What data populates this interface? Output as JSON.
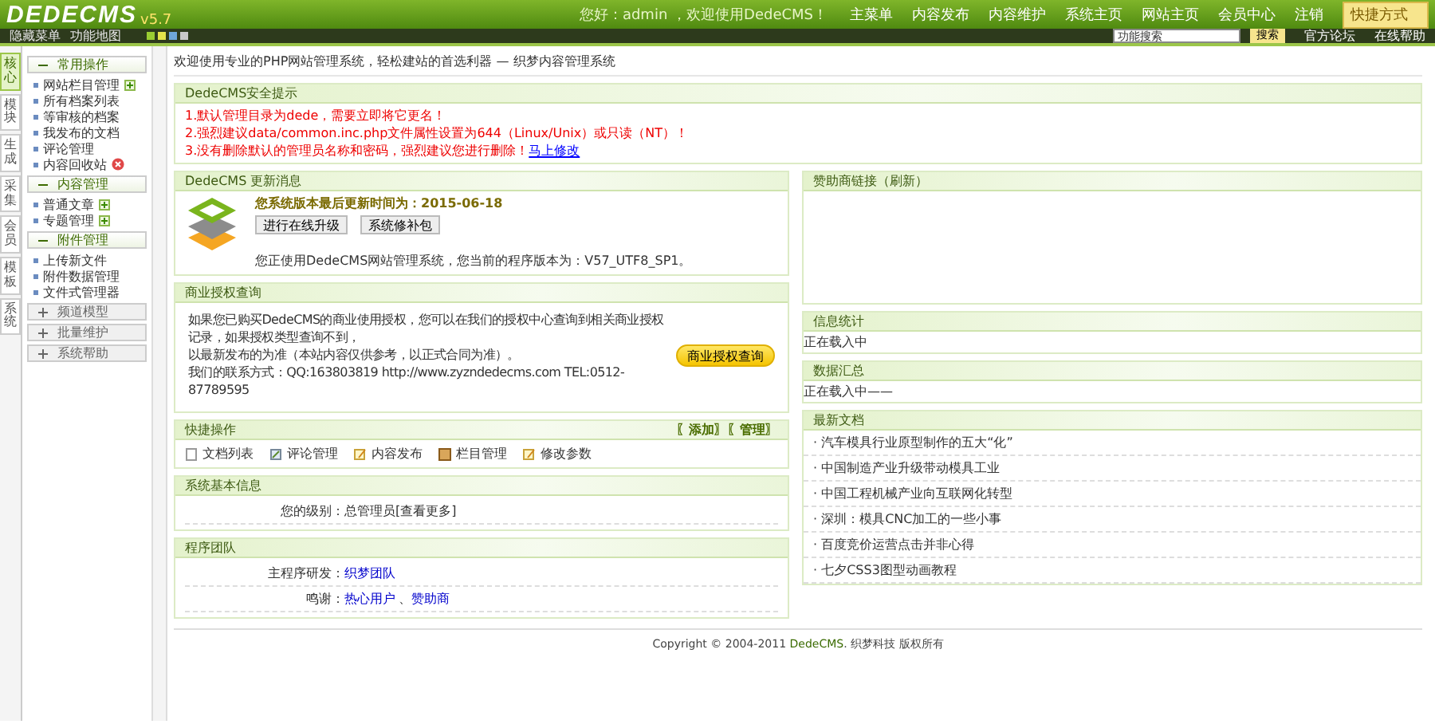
{
  "header": {
    "logo": "DEDECMS",
    "version": "v5.7",
    "greeting": "您好：admin ，欢迎使用DedeCMS！",
    "nav": [
      "主菜单",
      "内容发布",
      "内容维护",
      "系统主页",
      "网站主页",
      "会员中心",
      "注销"
    ],
    "shortcut": "快捷方式"
  },
  "toolbar": {
    "links": [
      "隐藏菜单",
      "功能地图"
    ],
    "skins": [
      {
        "color": "#9acd32"
      },
      {
        "color": "#e3e34a"
      },
      {
        "color": "#6ea6d8"
      },
      {
        "color": "#c8c8c8"
      }
    ],
    "search": {
      "value": "功能搜索",
      "button": "搜索"
    },
    "help_links": [
      "官方论坛",
      "在线帮助"
    ]
  },
  "side_tabs": [
    {
      "label": "核心",
      "selected": true
    },
    {
      "label": "模块",
      "selected": false
    },
    {
      "label": "生成",
      "selected": false
    },
    {
      "label": "采集",
      "selected": false
    },
    {
      "label": "会员",
      "selected": false
    },
    {
      "label": "模板",
      "selected": false
    },
    {
      "label": "系统",
      "selected": false
    }
  ],
  "sidebar": [
    {
      "title": "常用操作",
      "expanded": true,
      "items": [
        {
          "label": "网站栏目管理",
          "kind": "add"
        },
        {
          "label": "所有档案列表",
          "kind": "plain"
        },
        {
          "label": "等审核的档案",
          "kind": "plain"
        },
        {
          "label": "我发布的文档",
          "kind": "plain"
        },
        {
          "label": "评论管理",
          "kind": "plain"
        },
        {
          "label": "内容回收站",
          "kind": "trash"
        }
      ]
    },
    {
      "title": "内容管理",
      "expanded": true,
      "items": [
        {
          "label": "普通文章",
          "kind": "add"
        },
        {
          "label": "专题管理",
          "kind": "add"
        }
      ]
    },
    {
      "title": "附件管理",
      "expanded": true,
      "items": [
        {
          "label": "上传新文件",
          "kind": "plain"
        },
        {
          "label": "附件数据管理",
          "kind": "plain"
        },
        {
          "label": "文件式管理器",
          "kind": "plain"
        }
      ]
    },
    {
      "title": "频道模型",
      "expanded": false
    },
    {
      "title": "批量维护",
      "expanded": false
    },
    {
      "title": "系统帮助",
      "expanded": false
    }
  ],
  "welcome": "欢迎使用专业的PHP网站管理系统，轻松建站的首选利器 — 织梦内容管理系统",
  "security": {
    "title": "DedeCMS安全提示",
    "tips": [
      "1.默认管理目录为dede，需要立即将它更名！",
      "2.强烈建议data/common.inc.php文件属性设置为644（Linux/Unix）或只读（NT）！",
      "3.没有删除默认的管理员名称和密码，强烈建议您进行删除！"
    ],
    "link": "马上修改"
  },
  "update": {
    "title": "DedeCMS 更新消息",
    "headline": "您系统版本最后更新时间为：2015-06-18",
    "buttons": [
      "进行在线升级",
      "系统修补包"
    ],
    "note": "您正使用DedeCMS网站管理系统，您当前的程序版本为：V57_UTF8_SP1。"
  },
  "license": {
    "title": "商业授权查询",
    "lines": [
      "如果您已购买DedeCMS的商业使用授权，您可以在我们的授权中心查询到相关商业授权记录，如果授权类型查询不到，",
      "以最新发布的为准（本站内容仅供参考，以正式合同为准）。",
      "我们的联系方式：QQ:163803819 http://www.zyzndedecms.com TEL:0512-87789595"
    ],
    "button": "商业授权查询"
  },
  "quick": {
    "title": "快捷操作",
    "actions": [
      "〖添加〗",
      "〖管理〗"
    ],
    "items": [
      "文档列表",
      "评论管理",
      "内容发布",
      "栏目管理",
      "修改参数"
    ]
  },
  "sysinfo": {
    "title": "系统基本信息",
    "rows": [
      {
        "label": "您的级别：",
        "value": "总管理员",
        "link": "[查看更多]"
      }
    ]
  },
  "team": {
    "title": "程序团队",
    "rows": [
      {
        "label": "主程序研发：",
        "links": [
          "织梦团队"
        ]
      },
      {
        "label": "鸣谢：",
        "links": [
          "热心用户",
          "赞助商"
        ],
        "separator": "、"
      }
    ]
  },
  "sponsor": {
    "title": "赞助商链接（刷新）"
  },
  "stats": {
    "title": "信息统计",
    "text": "正在载入中"
  },
  "sql": {
    "title": "数据汇总",
    "text": "正在载入中——"
  },
  "latest": {
    "title": "最新文档",
    "items": [
      "· 汽车模具行业原型制作的五大“化”",
      "· 中国制造产业升级带动模具工业",
      "· 中国工程机械产业向互联网化转型",
      "· 深圳：模具CNC加工的一些小事",
      "· 百度竞价运营点击并非心得",
      "· 七夕CSS3图型动画教程"
    ]
  },
  "footer": {
    "copyright": "Copyright © 2004-2011 ",
    "brand": "DedeCMS",
    "rest": ". 织梦科技 版权所有"
  }
}
